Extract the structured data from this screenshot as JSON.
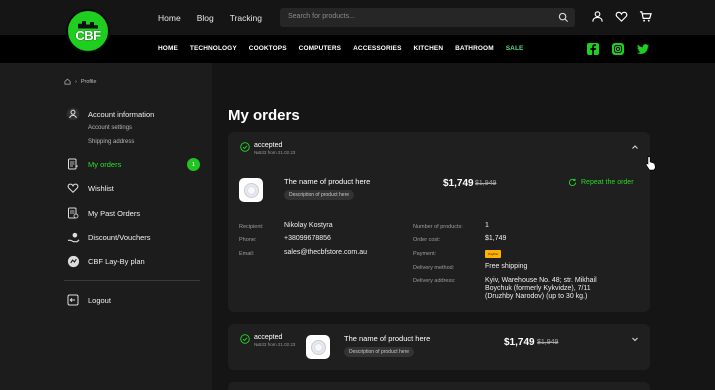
{
  "header": {
    "logo_text": "CBF",
    "nav": [
      "Home",
      "Blog",
      "Tracking"
    ],
    "search_placeholder": "Search for products..."
  },
  "categories": [
    "HOME",
    "TECHNOLOGY",
    "COOKTOPS",
    "COMPUTERS",
    "ACCESSORIES",
    "KITCHEN",
    "BATHROOM",
    "SALE"
  ],
  "breadcrumb": {
    "current": "Profile"
  },
  "sidebar": {
    "account_info": "Account information",
    "account_settings": "Account settings",
    "shipping_address": "Shipping address",
    "my_orders": "My orders",
    "my_orders_count": "1",
    "wishlist": "Wishlist",
    "past_orders": "My Past Orders",
    "discounts": "Discount/Vouchers",
    "layby": "CBF Lay-By plan",
    "logout": "Logout"
  },
  "page_title": "My orders",
  "orders": [
    {
      "status": "accepted",
      "number_date": "№533 from 21.02.23",
      "product_name": "The name of product here",
      "product_desc": "Description of product here",
      "price": "$1,749",
      "old_price": "$1,949",
      "repeat_label": "Repeat the order",
      "details_left": [
        {
          "label": "Recipient:",
          "value": "Nikolay Kostyra"
        },
        {
          "label": "Phone:",
          "value": "+38099678856"
        },
        {
          "label": "Email:",
          "value": "sales@thecbfstore.com.au"
        }
      ],
      "details_right": {
        "num_products_label": "Number of products:",
        "num_products": "1",
        "order_cost_label": "Order cost:",
        "order_cost": "$1,749",
        "payment_label": "Payment:",
        "payment_badge": "PayPal",
        "delivery_method_label": "Delivery method:",
        "delivery_method": "Free shipping",
        "delivery_address_label": "Delivery address:",
        "delivery_address_1": "Kyiv, Warehouse No. 48; str. Mikhail",
        "delivery_address_2": "Boychuk (formerly Kykvidze), 7/11",
        "delivery_address_3": "(Druzhby Narodov) (up to 30 kg.)"
      }
    },
    {
      "status": "accepted",
      "number_date": "№533 from 21.02.23",
      "product_name": "The name of product here",
      "product_desc": "Description of product here",
      "price": "$1,749",
      "old_price": "$1,949"
    }
  ],
  "colors": {
    "accent": "#27d827",
    "background": "#151515",
    "sidebar": "#1c1c1c",
    "card": "#1f1f1f"
  }
}
